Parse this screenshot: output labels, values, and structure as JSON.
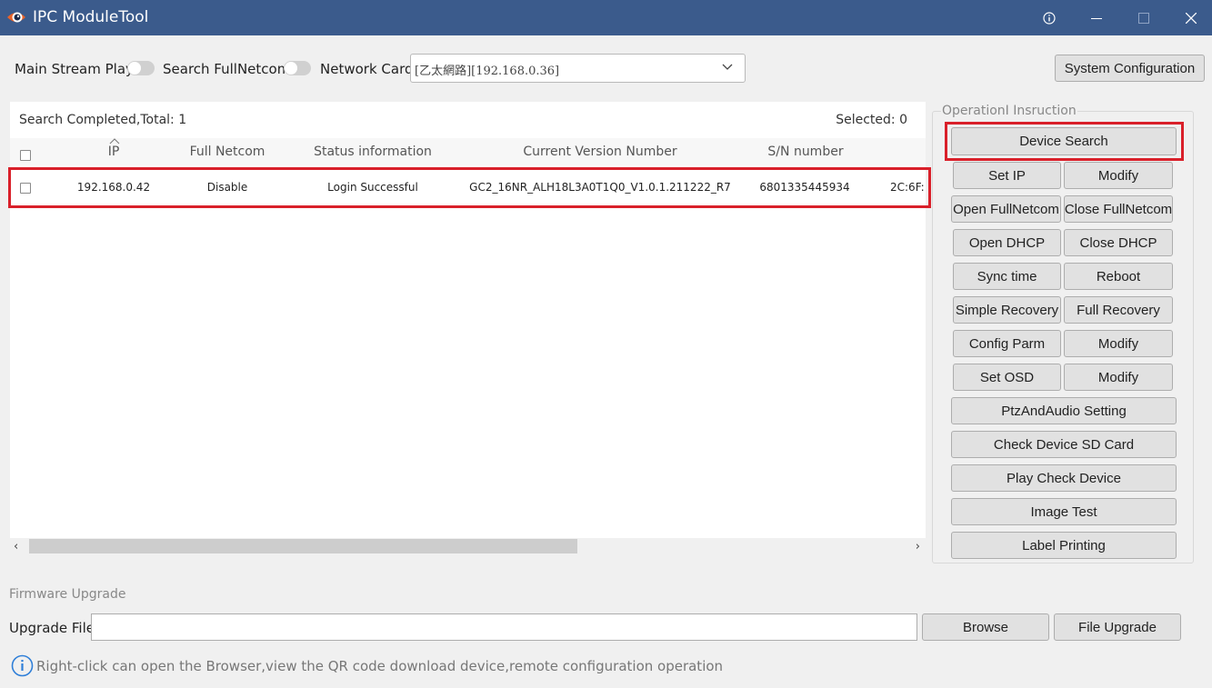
{
  "window": {
    "title": "IPC ModuleTool",
    "icons": {
      "logo": "camera-eye-logo",
      "info": "info-icon",
      "minimize": "minimize-icon",
      "maximize": "maximize-icon",
      "close": "close-icon"
    }
  },
  "toolbar": {
    "main_stream_label": "Main Stream Play",
    "search_fullnetcom_label": "Search FullNetcom",
    "network_card_label": "Network Card",
    "network_card_value": "[乙太網路][192.168.0.36]",
    "system_config_label": "System Configuration"
  },
  "table": {
    "status": "Search Completed,Total:  1",
    "selected": "Selected: 0",
    "columns": [
      "IP",
      "Full Netcom",
      "Status information",
      "Current Version Number",
      "S/N number"
    ],
    "rows": [
      {
        "ip": "192.168.0.42",
        "full_netcom": "Disable",
        "status": "Login Successful",
        "version": "GC2_16NR_ALH18L3A0T1Q0_V1.0.1.211222_R7",
        "sn": "6801335445934",
        "mac": "2C:6F:"
      }
    ]
  },
  "operations": {
    "title": "OperationI Insruction",
    "device_search": "Device Search",
    "buttons": [
      [
        "Set IP",
        "Modify"
      ],
      [
        "Open FullNetcom",
        "Close FullNetcom"
      ],
      [
        "Open DHCP",
        "Close DHCP"
      ],
      [
        "Sync time",
        "Reboot"
      ],
      [
        "Simple Recovery",
        "Full Recovery"
      ],
      [
        "Config Parm",
        "Modify"
      ],
      [
        "Set OSD",
        "Modify"
      ]
    ],
    "wide_buttons": [
      "PtzAndAudio Setting",
      "Check Device SD Card",
      "Play Check Device",
      "Image Test",
      "Label Printing"
    ]
  },
  "firmware": {
    "section_title": "Firmware Upgrade",
    "upgrade_file_label": "Upgrade File",
    "upgrade_file_value": "",
    "browse_label": "Browse",
    "file_upgrade_label": "File Upgrade"
  },
  "hint": "Right-click can open the Browser,view the QR code download device,remote configuration operation",
  "colors": {
    "titlebar": "#3b5b8c",
    "highlight": "#d9202a",
    "background": "#f0f0f0",
    "info_blue": "#2f7fd8"
  }
}
